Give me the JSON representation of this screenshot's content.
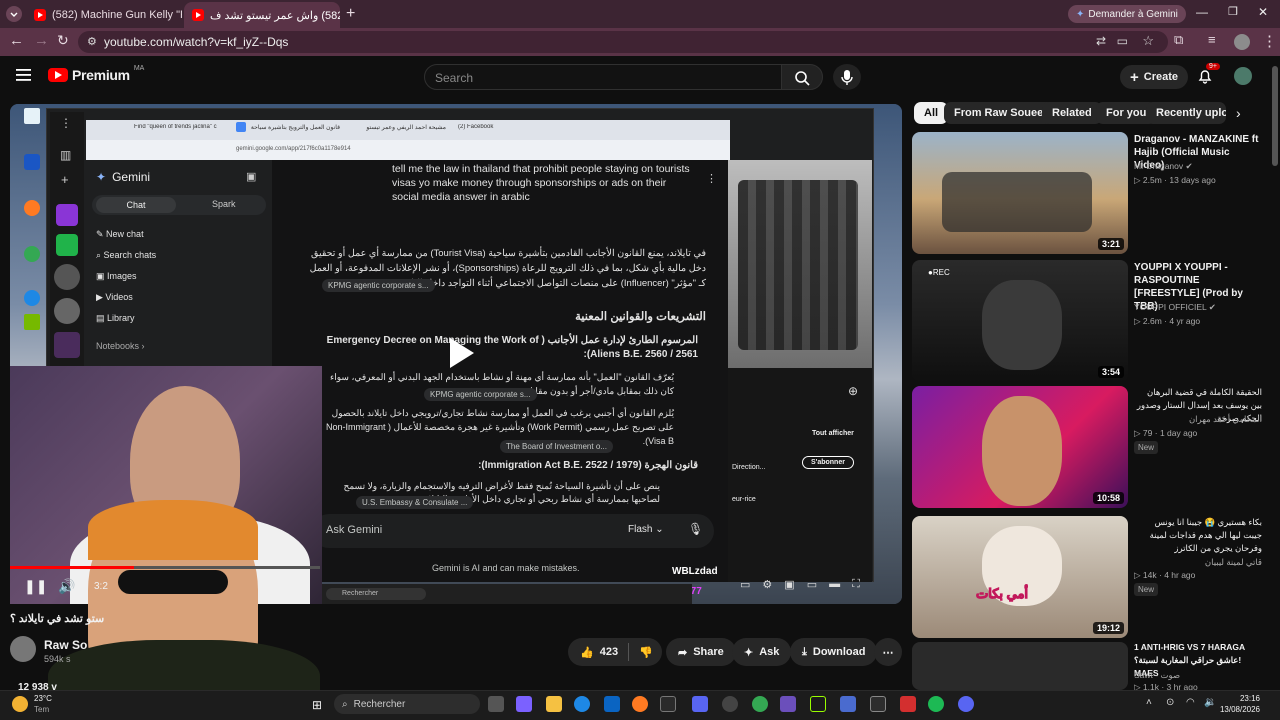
{
  "browser": {
    "tabs": [
      {
        "title": "(582) Machine Gun Kelly \"Rap D",
        "active": false
      },
      {
        "title": "(582) واش عمر تيستو تشد ف",
        "active": true
      }
    ],
    "new_tab": "+",
    "gemini_button": "Demander à Gemini",
    "url": "youtube.com/watch?v=kf_iyZ--Dqs"
  },
  "youtube": {
    "logo": "Premium",
    "logo_region": "MA",
    "search_placeholder": "Search",
    "create_label": "Create",
    "notif_count": "9+",
    "channel_name": "Raw So",
    "subscribers": "594k s",
    "video_title_partial": "ستو تشد في تايلاند ؟",
    "views_partial": "12 938 v",
    "actions": {
      "likes": "423",
      "share": "Share",
      "ask": "Ask",
      "download": "Download"
    },
    "chips": [
      "All",
      "From Raw Soueelt",
      "Related",
      "For you",
      "Recently uploaded"
    ],
    "recommendations": [
      {
        "title": "Draganov - MANZAKINE ft Hajib (Official Music Video)",
        "channel": "Mr Draganov",
        "views": "2.5m",
        "age": "13 days ago",
        "duration": "3:21",
        "new": false
      },
      {
        "title": "YOUPPI X YOUPPI - RASPOUTINE [FREESTYLE] (Prod by TBB)",
        "channel": "YOUPPI OFFICIEL",
        "views": "2.6m",
        "age": "4 yr ago",
        "duration": "3:54",
        "new": false
      },
      {
        "title": "الحقيقة الكاملة في قضية البرهان بين يوسف بعد إسدال الستار وصدور الحكم صرخة",
        "channel": "المحامي أحمد مهران",
        "views": "79",
        "age": "1 day ago",
        "duration": "10:58",
        "new": true
      },
      {
        "title": "بكاء هستيري 😭 جيبنا انا يونس جيبت ليها الي هدم فداجات لمينة وفرحان يجري من الكاترز",
        "channel": "قاتي لمينة ليبيان",
        "views": "14k",
        "age": "4 hr ago",
        "duration": "19:12",
        "new": true
      },
      {
        "title": "1 ANTI-HRIG VS 7 HARAGA عاشق حراقي المغاربة لسبتة؟! MAES",
        "channel": "Sawt - صوت",
        "views": "1.1k",
        "age": "3 hr ago",
        "duration": "",
        "new": false
      }
    ]
  },
  "video_content": {
    "gemini_logo": "Gemini",
    "sidebar_tabs": [
      "Chat",
      "Spark"
    ],
    "sidebar_items": [
      "New chat",
      "Search chats",
      "Images",
      "Videos",
      "Library"
    ],
    "notebooks": "Notebooks",
    "inner_url": "gemini.google.com/app/217f6c0a1178e914",
    "inner_tabs": [
      "Find \"queen of trends jaclina\" c",
      "قانون العمل والترويج بتأشيرة سياحة",
      "مشيحة احمد الريفي وعمر تيستو",
      "(2) Facebook"
    ],
    "prompt_text": "tell me the law in thailand that prohibit people staying on tourists visas yo make money through sponsorships or ads on their social media answer in arabic",
    "answer_intro": "في تايلاند، يمنع القانون الأجانب القادمين بتأشيرة سياحية (Tourist Visa) من ممارسة أي عمل أو تحقيق دخل مالية بأي شكل، بما في ذلك الترويج للرعاة (Sponsorships)، أو نشر الإعلانات المدفوعة، أو العمل كـ \"مؤثر\" (Influencer) على منصات التواصل الاجتماعي أثناء التواجد داخل البلاد.",
    "heading": "التشريعات والقوانين المعنية",
    "item1_title": "المرسوم الطارئ لإدارة عمل الأجانب ( Emergency Decree on Managing the Work of Aliens B.E. 2560 / 2561):",
    "item1_b1": "يُعرّف القانون \"العمل\" بأنه ممارسة أي مهنة أو نشاط باستخدام الجهد البدني أو المعرفي، سواء كان ذلك بمقابل مادي/أجر أو بدون مقابل.",
    "item1_b2": "يُلزم القانون أي أجنبي يرغب في العمل أو ممارسة نشاط تجاري/ترويجي داخل تايلاند بالحصول على تصريح عمل رسمي (Work Permit) وتأشيرة غير هجرة مخصصة للأعمال ( Non-Immigrant Visa B).",
    "item2_title": "قانون الهجرة (Immigration Act B.E. 2522 / 1979):",
    "item2_b1": "ينص على أن تأشيرة السياحة تُمنح فقط لأغراض الترفيه والاستجمام والزيارة، ولا تسمح لصاحبها بممارسة أي نشاط ربحي أو تجاري داخل الأراضي التايلاندية.",
    "chips": [
      "KPMG agentic corporate s...",
      "KPMG agentic corporate s...",
      "The Board of Investment o...",
      "U.S. Embassy & Consulate ..."
    ],
    "ask_placeholder": "Ask Gemini",
    "model": "Flash",
    "disclaimer": "Gemini is AI and can make mistakes.",
    "overlay_brand": "WBLzdad",
    "overlay_user": "youyou7777",
    "inner_search": "Rechercher",
    "inner_subscribe": "S'abonner",
    "inner_showall": "Tout afficher",
    "inner_direction": "Direction...",
    "inner_price": "eur-rice",
    "time_label": "3:2"
  },
  "os": {
    "weather_temp": "23°C",
    "weather_label": "Tem",
    "search_placeholder": "Rechercher",
    "time": "23:16",
    "date": "13/08/2026"
  },
  "colors": {
    "tab_strip": "#3c2432",
    "toolbar": "#5a3347",
    "yt_red": "#ff0000",
    "bg": "#0f0f0f"
  }
}
